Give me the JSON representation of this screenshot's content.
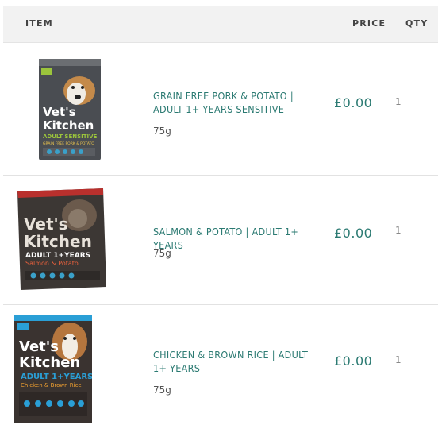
{
  "header": {
    "item": "ITEM",
    "price": "PRICE",
    "qty": "QTY"
  },
  "items": [
    {
      "name": "GRAIN FREE PORK & POTATO | ADULT 1+ YEARS SENSITIVE",
      "size": "75g",
      "price": "£0.00",
      "qty": "1",
      "image_text": [
        "Vet's",
        "Kitchen",
        "ADULT SENSITIVE",
        "GRAIN FREE PORK & POTATO"
      ]
    },
    {
      "name": "SALMON & POTATO | ADULT 1+ YEARS",
      "size": "75g",
      "price": "£0.00",
      "qty": "1",
      "image_text": [
        "Vet's",
        "Kitchen",
        "ADULT 1+YEARS",
        "Salmon & Potato"
      ]
    },
    {
      "name": "CHICKEN & BROWN RICE | ADULT 1+ YEARS",
      "size": "75g",
      "price": "£0.00",
      "qty": "1",
      "image_text": [
        "Vet's",
        "Kitchen",
        "ADULT 1+YEARS",
        "Chicken & Brown Rice"
      ]
    }
  ]
}
